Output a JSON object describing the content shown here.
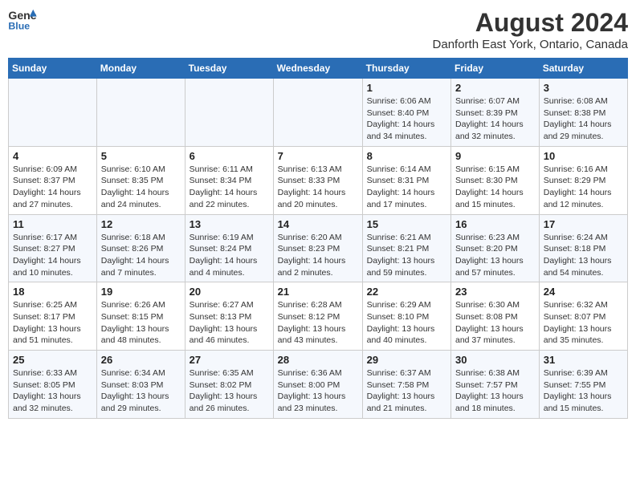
{
  "header": {
    "logo_line1": "General",
    "logo_line2": "Blue",
    "title": "August 2024",
    "subtitle": "Danforth East York, Ontario, Canada"
  },
  "calendar": {
    "days_of_week": [
      "Sunday",
      "Monday",
      "Tuesday",
      "Wednesday",
      "Thursday",
      "Friday",
      "Saturday"
    ],
    "weeks": [
      [
        {
          "day": "",
          "info": ""
        },
        {
          "day": "",
          "info": ""
        },
        {
          "day": "",
          "info": ""
        },
        {
          "day": "",
          "info": ""
        },
        {
          "day": "1",
          "info": "Sunrise: 6:06 AM\nSunset: 8:40 PM\nDaylight: 14 hours\nand 34 minutes."
        },
        {
          "day": "2",
          "info": "Sunrise: 6:07 AM\nSunset: 8:39 PM\nDaylight: 14 hours\nand 32 minutes."
        },
        {
          "day": "3",
          "info": "Sunrise: 6:08 AM\nSunset: 8:38 PM\nDaylight: 14 hours\nand 29 minutes."
        }
      ],
      [
        {
          "day": "4",
          "info": "Sunrise: 6:09 AM\nSunset: 8:37 PM\nDaylight: 14 hours\nand 27 minutes."
        },
        {
          "day": "5",
          "info": "Sunrise: 6:10 AM\nSunset: 8:35 PM\nDaylight: 14 hours\nand 24 minutes."
        },
        {
          "day": "6",
          "info": "Sunrise: 6:11 AM\nSunset: 8:34 PM\nDaylight: 14 hours\nand 22 minutes."
        },
        {
          "day": "7",
          "info": "Sunrise: 6:13 AM\nSunset: 8:33 PM\nDaylight: 14 hours\nand 20 minutes."
        },
        {
          "day": "8",
          "info": "Sunrise: 6:14 AM\nSunset: 8:31 PM\nDaylight: 14 hours\nand 17 minutes."
        },
        {
          "day": "9",
          "info": "Sunrise: 6:15 AM\nSunset: 8:30 PM\nDaylight: 14 hours\nand 15 minutes."
        },
        {
          "day": "10",
          "info": "Sunrise: 6:16 AM\nSunset: 8:29 PM\nDaylight: 14 hours\nand 12 minutes."
        }
      ],
      [
        {
          "day": "11",
          "info": "Sunrise: 6:17 AM\nSunset: 8:27 PM\nDaylight: 14 hours\nand 10 minutes."
        },
        {
          "day": "12",
          "info": "Sunrise: 6:18 AM\nSunset: 8:26 PM\nDaylight: 14 hours\nand 7 minutes."
        },
        {
          "day": "13",
          "info": "Sunrise: 6:19 AM\nSunset: 8:24 PM\nDaylight: 14 hours\nand 4 minutes."
        },
        {
          "day": "14",
          "info": "Sunrise: 6:20 AM\nSunset: 8:23 PM\nDaylight: 14 hours\nand 2 minutes."
        },
        {
          "day": "15",
          "info": "Sunrise: 6:21 AM\nSunset: 8:21 PM\nDaylight: 13 hours\nand 59 minutes."
        },
        {
          "day": "16",
          "info": "Sunrise: 6:23 AM\nSunset: 8:20 PM\nDaylight: 13 hours\nand 57 minutes."
        },
        {
          "day": "17",
          "info": "Sunrise: 6:24 AM\nSunset: 8:18 PM\nDaylight: 13 hours\nand 54 minutes."
        }
      ],
      [
        {
          "day": "18",
          "info": "Sunrise: 6:25 AM\nSunset: 8:17 PM\nDaylight: 13 hours\nand 51 minutes."
        },
        {
          "day": "19",
          "info": "Sunrise: 6:26 AM\nSunset: 8:15 PM\nDaylight: 13 hours\nand 48 minutes."
        },
        {
          "day": "20",
          "info": "Sunrise: 6:27 AM\nSunset: 8:13 PM\nDaylight: 13 hours\nand 46 minutes."
        },
        {
          "day": "21",
          "info": "Sunrise: 6:28 AM\nSunset: 8:12 PM\nDaylight: 13 hours\nand 43 minutes."
        },
        {
          "day": "22",
          "info": "Sunrise: 6:29 AM\nSunset: 8:10 PM\nDaylight: 13 hours\nand 40 minutes."
        },
        {
          "day": "23",
          "info": "Sunrise: 6:30 AM\nSunset: 8:08 PM\nDaylight: 13 hours\nand 37 minutes."
        },
        {
          "day": "24",
          "info": "Sunrise: 6:32 AM\nSunset: 8:07 PM\nDaylight: 13 hours\nand 35 minutes."
        }
      ],
      [
        {
          "day": "25",
          "info": "Sunrise: 6:33 AM\nSunset: 8:05 PM\nDaylight: 13 hours\nand 32 minutes."
        },
        {
          "day": "26",
          "info": "Sunrise: 6:34 AM\nSunset: 8:03 PM\nDaylight: 13 hours\nand 29 minutes."
        },
        {
          "day": "27",
          "info": "Sunrise: 6:35 AM\nSunset: 8:02 PM\nDaylight: 13 hours\nand 26 minutes."
        },
        {
          "day": "28",
          "info": "Sunrise: 6:36 AM\nSunset: 8:00 PM\nDaylight: 13 hours\nand 23 minutes."
        },
        {
          "day": "29",
          "info": "Sunrise: 6:37 AM\nSunset: 7:58 PM\nDaylight: 13 hours\nand 21 minutes."
        },
        {
          "day": "30",
          "info": "Sunrise: 6:38 AM\nSunset: 7:57 PM\nDaylight: 13 hours\nand 18 minutes."
        },
        {
          "day": "31",
          "info": "Sunrise: 6:39 AM\nSunset: 7:55 PM\nDaylight: 13 hours\nand 15 minutes."
        }
      ]
    ]
  }
}
